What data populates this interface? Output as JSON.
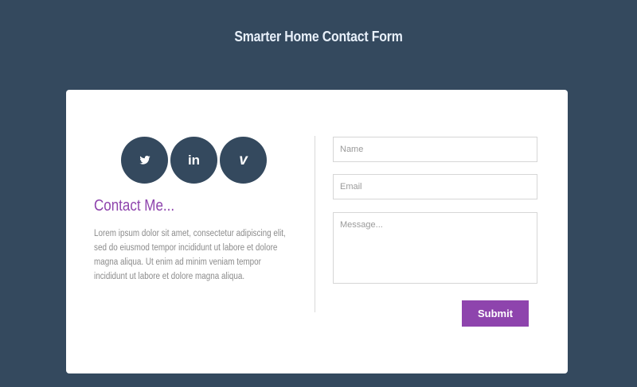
{
  "page": {
    "title": "Smarter Home Contact Form"
  },
  "colors": {
    "background": "#34495e",
    "card": "#ffffff",
    "accent": "#8e44ad",
    "social_circle": "#34495e"
  },
  "social": {
    "items": [
      {
        "name": "twitter",
        "icon": "twitter-icon"
      },
      {
        "name": "linkedin",
        "icon": "linkedin-icon",
        "glyph": "in"
      },
      {
        "name": "vimeo",
        "icon": "vimeo-icon",
        "glyph": "v"
      }
    ]
  },
  "contact": {
    "heading": "Contact Me...",
    "text": "Lorem ipsum dolor sit amet, consectetur adipiscing elit, sed do eiusmod tempor incididunt ut labore et dolore magna aliqua. Ut enim ad minim veniam tempor incididunt ut labore et dolore magna aliqua."
  },
  "form": {
    "name_placeholder": "Name",
    "name_value": "",
    "email_placeholder": "Email",
    "email_value": "",
    "message_placeholder": "Message...",
    "message_value": "",
    "submit_label": "Submit"
  }
}
